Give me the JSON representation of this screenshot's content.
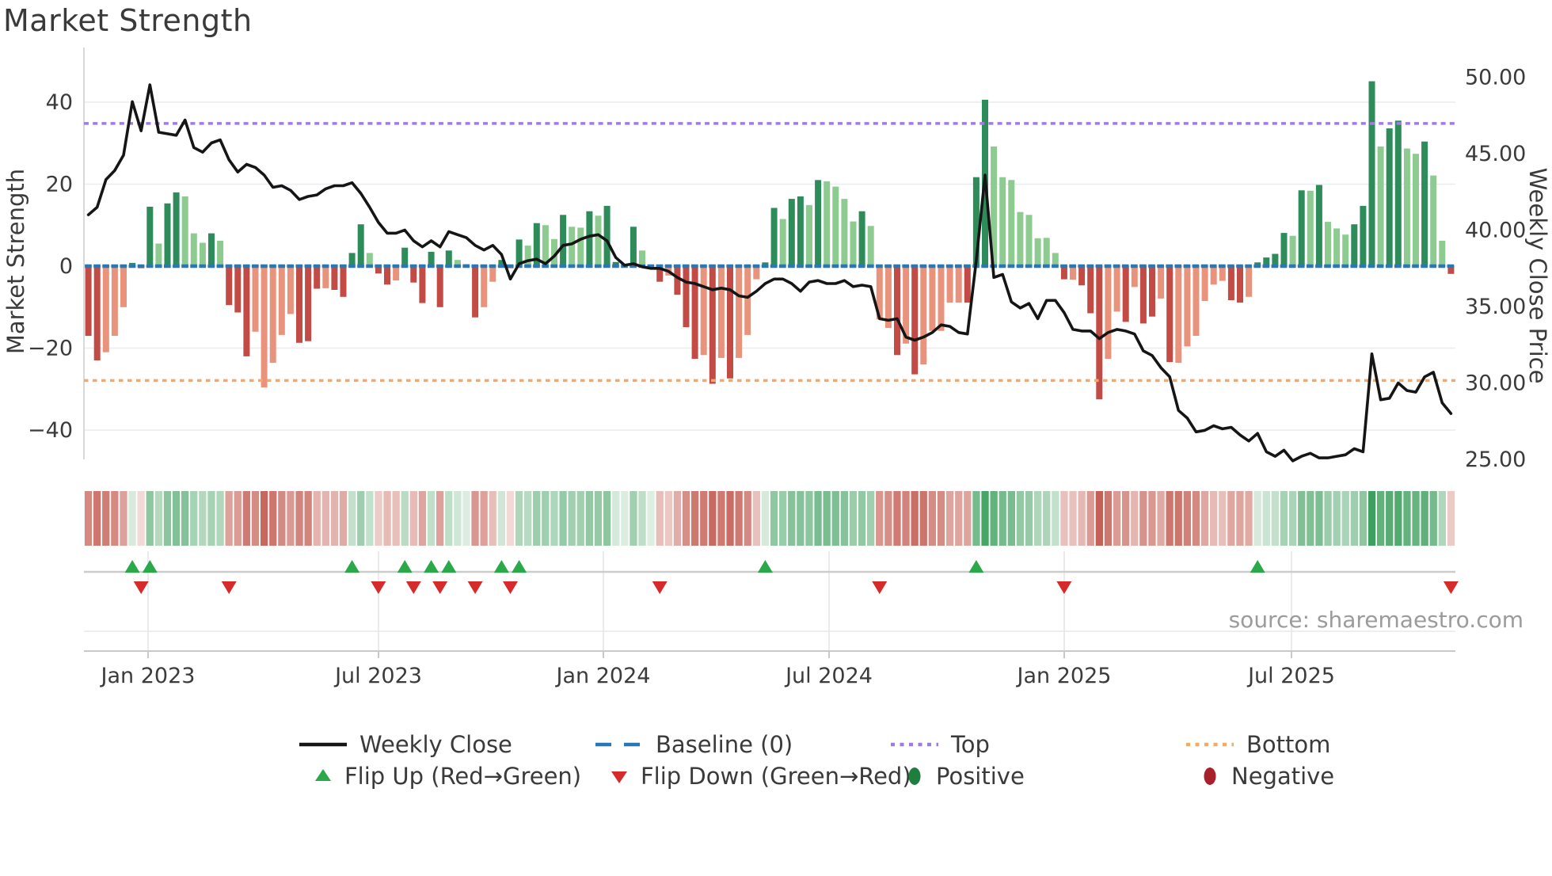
{
  "title": "Market Strength",
  "source_note": "source: sharemaestro.com",
  "axes": {
    "left": {
      "title": "Market Strength",
      "ticks": [
        "40",
        "20",
        "0",
        "−20",
        "−40"
      ],
      "tick_values": [
        40,
        20,
        0,
        -20,
        -40
      ]
    },
    "right": {
      "title": "Weekly Close Price",
      "ticks": [
        "50.00",
        "45.00",
        "40.00",
        "35.00",
        "30.00",
        "25.00"
      ],
      "tick_values": [
        50,
        45,
        40,
        35,
        30,
        25
      ]
    },
    "x": {
      "ticks": [
        "Jan 2023",
        "Jul 2023",
        "Jan 2024",
        "Jul 2024",
        "Jan 2025",
        "Jul 2025"
      ],
      "tick_x": [
        187,
        478,
        762,
        1047,
        1344,
        1631
      ]
    }
  },
  "legend": {
    "weekly_close": "Weekly Close",
    "baseline": "Baseline (0)",
    "top": "Top",
    "bottom": "Bottom",
    "flip_up": "Flip Up (Red→Green)",
    "flip_down": "Flip Down (Green→Red)",
    "positive": "Positive",
    "negative": "Negative"
  },
  "colors": {
    "bar_dark_green": "#2e8c5a",
    "bar_light_green": "#8ecb90",
    "bar_dark_red": "#c24b45",
    "bar_salmon": "#e9937d",
    "baseline_blue": "#2878b5",
    "top_purple": "#a07ce0",
    "bottom_orange": "#f5a965",
    "line_black": "#151515",
    "flip_up_green": "#2aa84a",
    "flip_down_red": "#d62b2b",
    "positive_green": "#1e7e3e",
    "negative_red": "#a8202c",
    "grid": "#e9ecf1",
    "heat_green_strong": "#3ea05e",
    "heat_red_strong": "#c55f55",
    "axis_text": "#3b3b3b",
    "source_gray": "#9b9b9b"
  },
  "chart_data": {
    "type": "combo_bar_line",
    "title": "Market Strength",
    "xlabel": "",
    "ylabel_left": "Market Strength",
    "ylabel_right": "Weekly Close Price",
    "x_tick_labels": [
      "Jan 2023",
      "Jul 2023",
      "Jan 2024",
      "Jul 2024",
      "Jan 2025",
      "Jul 2025"
    ],
    "x_range_weeks": 156,
    "x_span": "Nov 2022 - Nov 2025",
    "ylim_left": [
      -47,
      53
    ],
    "ylim_right": [
      25,
      51.9
    ],
    "grid": true,
    "legend_position": "bottom",
    "baseline": 0,
    "top_level": 34.8,
    "bottom_level": -27.9,
    "series": [
      {
        "name": "Market Strength",
        "type": "bar",
        "axis": "left",
        "values": [
          -17,
          -23,
          -21,
          -17,
          -10,
          0.8,
          -0.5,
          14.5,
          5.5,
          15.3,
          18,
          17,
          8,
          5.7,
          8,
          6.2,
          -9.5,
          -11.3,
          -22,
          -16,
          -29.6,
          -23.6,
          -16.8,
          -11.7,
          -18.7,
          -18.3,
          -5.5,
          -5.4,
          -5.8,
          -7.5,
          3.2,
          10.2,
          3.2,
          -1.8,
          -4.5,
          -3.5,
          4.5,
          -4,
          -9,
          3.5,
          -10,
          3.8,
          1.5,
          0.5,
          -12.5,
          -10,
          -3.8,
          1.5,
          -0.5,
          6.5,
          5,
          10.5,
          10,
          6.6,
          12.5,
          9.6,
          9.4,
          13.4,
          12.3,
          14.7,
          1.0,
          0.5,
          9.6,
          3.8,
          0.3,
          -3.8,
          -2.3,
          -7,
          -14.9,
          -22.6,
          -21.7,
          -28.7,
          -22.4,
          -27.4,
          -22.4,
          -16.8,
          -3.2,
          0.9,
          14.2,
          11.5,
          16.4,
          17,
          14.9,
          21,
          20.7,
          19.4,
          16.4,
          10.9,
          13.4,
          9.8,
          -13,
          -15.1,
          -21.7,
          -18.9,
          -26.4,
          -24,
          -15.8,
          -15.8,
          -8.9,
          -8.9,
          -8.9,
          21.7,
          40.6,
          29.2,
          21.7,
          21,
          13.2,
          12.5,
          6.8,
          6.9,
          3.2,
          -3.2,
          -3.3,
          -4.7,
          -11.5,
          -32.5,
          -22.6,
          -11.1,
          -13.6,
          -5.1,
          -14,
          -12.3,
          -7.9,
          -23.4,
          -23.6,
          -19.6,
          -17,
          -8.5,
          -4.5,
          -3.6,
          -8.3,
          -8.9,
          -7.5,
          0.9,
          2.1,
          3.0,
          8.1,
          7.4,
          18.5,
          18.4,
          19.8,
          10.8,
          9.2,
          7.7,
          10.2,
          14.7,
          45.1,
          29.2,
          33.6,
          35.5,
          28.7,
          27.4,
          30.4,
          22.1,
          6.2,
          -1.9
        ],
        "bar_classes": [
          "dr",
          "dr",
          "sr",
          "sr",
          "sr",
          "dg",
          "dr",
          "dg",
          "lg",
          "dg",
          "dg",
          "lg",
          "lg",
          "lg",
          "dg",
          "lg",
          "dr",
          "dr",
          "dr",
          "sr",
          "sr",
          "sr",
          "sr",
          "sr",
          "dr",
          "dr",
          "dr",
          "sr",
          "dr",
          "dr",
          "dg",
          "dg",
          "lg",
          "dr",
          "dr",
          "sr",
          "dg",
          "dr",
          "dr",
          "dg",
          "dr",
          "dg",
          "lg",
          "lg",
          "dr",
          "sr",
          "sr",
          "dg",
          "dr",
          "dg",
          "lg",
          "dg",
          "lg",
          "lg",
          "dg",
          "lg",
          "lg",
          "dg",
          "lg",
          "dg",
          "dg",
          "lg",
          "dg",
          "lg",
          "lg",
          "dr",
          "sr",
          "dr",
          "dr",
          "dr",
          "sr",
          "dr",
          "sr",
          "dr",
          "sr",
          "sr",
          "sr",
          "dg",
          "dg",
          "lg",
          "dg",
          "dg",
          "lg",
          "dg",
          "lg",
          "lg",
          "lg",
          "lg",
          "dg",
          "lg",
          "sr",
          "sr",
          "dr",
          "sr",
          "dr",
          "sr",
          "sr",
          "sr",
          "sr",
          "sr",
          "dr",
          "dg",
          "dg",
          "lg",
          "lg",
          "lg",
          "lg",
          "lg",
          "lg",
          "lg",
          "lg",
          "dr",
          "sr",
          "dr",
          "dr",
          "dr",
          "sr",
          "sr",
          "dr",
          "sr",
          "dr",
          "dr",
          "sr",
          "dr",
          "sr",
          "sr",
          "sr",
          "sr",
          "sr",
          "sr",
          "dr",
          "dr",
          "sr",
          "dg",
          "dg",
          "dg",
          "dg",
          "lg",
          "dg",
          "lg",
          "dg",
          "lg",
          "lg",
          "lg",
          "dg",
          "dg",
          "dg",
          "lg",
          "dg",
          "dg",
          "lg",
          "lg",
          "dg",
          "lg",
          "lg",
          "dr"
        ]
      },
      {
        "name": "Weekly Close",
        "type": "line",
        "axis": "right",
        "values": [
          41.0,
          41.5,
          43.3,
          43.9,
          44.9,
          48.4,
          46.5,
          49.5,
          46.4,
          46.3,
          46.2,
          47.2,
          45.4,
          45.1,
          45.7,
          45.9,
          44.6,
          43.8,
          44.3,
          44.1,
          43.6,
          42.8,
          42.9,
          42.6,
          42.0,
          42.2,
          42.3,
          42.7,
          42.9,
          42.9,
          43.1,
          42.4,
          41.5,
          40.5,
          39.8,
          39.8,
          40.0,
          39.3,
          38.9,
          39.3,
          38.9,
          39.9,
          39.7,
          39.5,
          39.0,
          38.7,
          39.0,
          38.4,
          36.8,
          37.8,
          38.0,
          38.1,
          37.8,
          38.3,
          39.0,
          39.1,
          39.4,
          39.6,
          39.7,
          39.3,
          38.2,
          37.7,
          37.8,
          37.6,
          37.5,
          37.5,
          37.3,
          36.9,
          36.6,
          36.5,
          36.3,
          36.1,
          36.2,
          36.1,
          35.7,
          35.6,
          36.0,
          36.5,
          36.8,
          36.8,
          36.5,
          36.0,
          36.6,
          36.7,
          36.5,
          36.5,
          36.7,
          36.3,
          36.4,
          36.3,
          34.2,
          34.1,
          34.2,
          33.0,
          32.8,
          33.0,
          33.3,
          33.8,
          33.7,
          33.3,
          33.2,
          38.0,
          43.6,
          36.9,
          37.1,
          35.3,
          34.9,
          35.2,
          34.2,
          35.4,
          35.4,
          34.6,
          33.5,
          33.4,
          33.4,
          32.9,
          33.3,
          33.5,
          33.4,
          33.2,
          32.1,
          31.8,
          31.0,
          30.4,
          28.2,
          27.7,
          26.8,
          26.9,
          27.2,
          27.0,
          27.1,
          26.6,
          26.2,
          26.7,
          25.5,
          25.2,
          25.6,
          24.9,
          25.2,
          25.4,
          25.1,
          25.1,
          25.2,
          25.3,
          25.7,
          25.5,
          31.9,
          28.9,
          29.0,
          30.0,
          29.5,
          29.4,
          30.4,
          30.7,
          28.7,
          28.0
        ]
      }
    ],
    "flip_up_weeks": [
      5,
      7,
      30,
      36,
      39,
      41,
      47,
      49,
      77,
      101,
      133
    ],
    "flip_down_weeks": [
      6,
      16,
      33,
      37,
      40,
      44,
      48,
      65,
      90,
      111,
      155
    ],
    "heatmap": "strip below main chart encodes the bar values red→green by intensity"
  }
}
